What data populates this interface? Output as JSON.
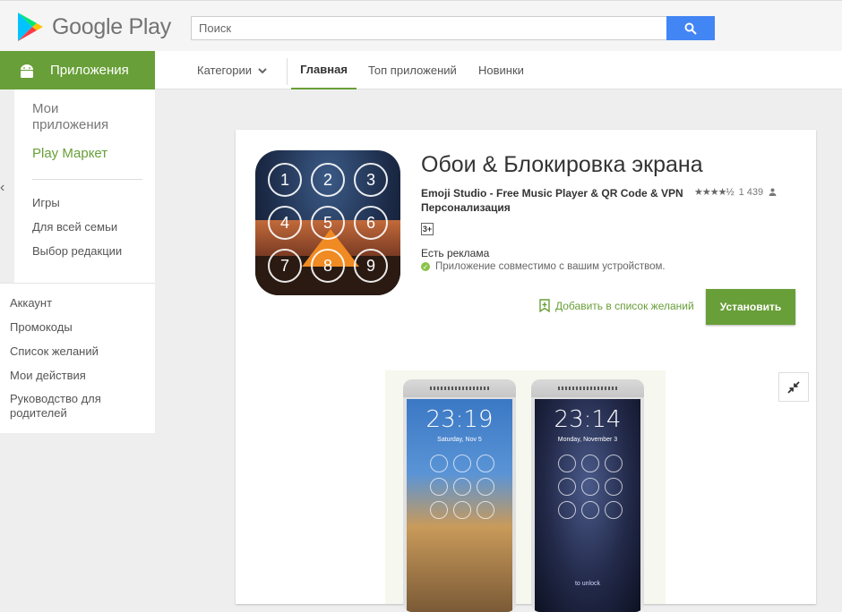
{
  "header": {
    "logo_text": "Google Play",
    "search_placeholder": "Поиск"
  },
  "nav": {
    "apps_label": "Приложения",
    "categories_label": "Категории",
    "tabs": [
      {
        "label": "Главная"
      },
      {
        "label": "Топ приложений"
      },
      {
        "label": "Новинки"
      }
    ]
  },
  "sidebar": {
    "my_apps": "Мои приложения",
    "play_market": "Play Маркет",
    "items": [
      {
        "label": "Игры"
      },
      {
        "label": "Для всей семьи"
      },
      {
        "label": "Выбор редакции"
      }
    ],
    "account_items": [
      {
        "label": "Аккаунт"
      },
      {
        "label": "Промокоды"
      },
      {
        "label": "Список желаний"
      },
      {
        "label": "Мои действия"
      },
      {
        "label": "Руководство для родителей"
      }
    ]
  },
  "app": {
    "title": "Обои & Блокировка экрана",
    "developer": "Emoji Studio - Free Music Player & QR Code & VPN",
    "category": "Персонализация",
    "rating_stars": 4.5,
    "rating_count": "1 439",
    "age_rating": "3+",
    "ads_label": "Есть реклама",
    "compat_text": "Приложение совместимо с вашим устройством.",
    "wishlist_label": "Добавить в список желаний",
    "install_label": "Установить",
    "keypad": [
      "1",
      "2",
      "3",
      "4",
      "5",
      "6",
      "7",
      "8",
      "9"
    ]
  },
  "screenshots": [
    {
      "time": "23:19",
      "date": "Saturday, Nov 5"
    },
    {
      "time": "23:14",
      "date": "Monday, November 3",
      "unlock": "to unlock"
    }
  ],
  "colors": {
    "green": "#689f38",
    "blue": "#4285f4"
  }
}
